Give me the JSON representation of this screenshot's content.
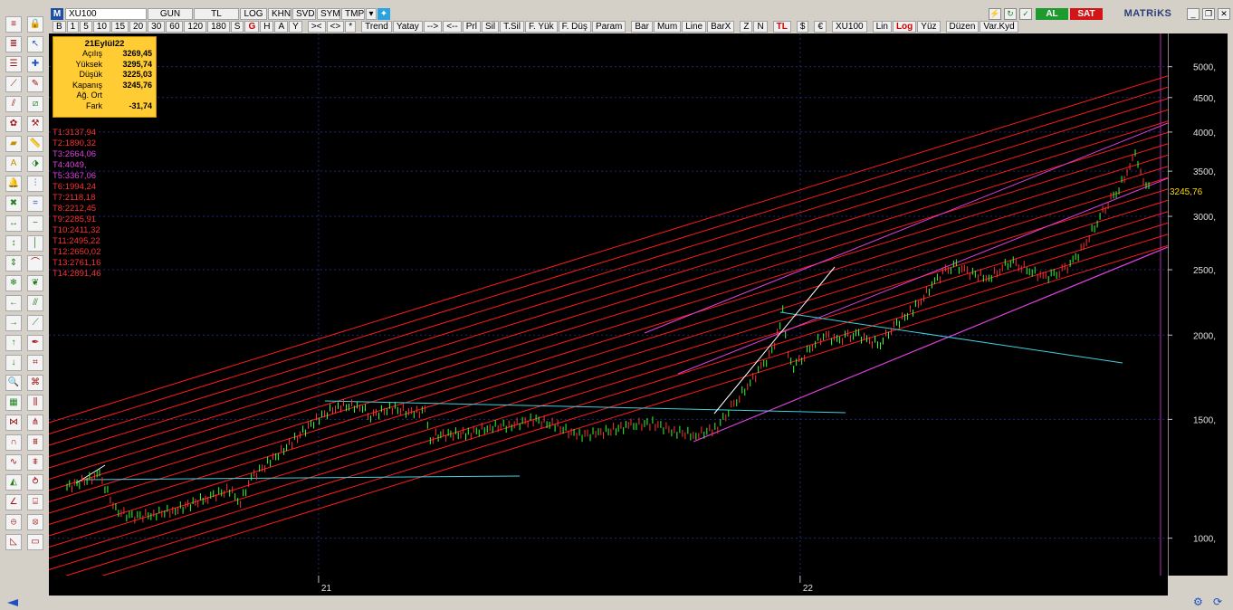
{
  "toolbar1": {
    "m_label": "M",
    "symbol": "XU100",
    "items": [
      "GUN",
      "TL",
      "LOG",
      "KHN",
      "SVD",
      "SYM",
      "TMP"
    ]
  },
  "toolbar2": {
    "periods": [
      "B",
      "1",
      "5",
      "10",
      "15",
      "20",
      "30",
      "60",
      "120",
      "180",
      "S"
    ],
    "g_label": "G",
    "more": [
      "H",
      "A",
      "Y"
    ],
    "nav": [
      "><",
      "<>",
      "*"
    ],
    "tools": [
      "Trend",
      "Yatay",
      "-->",
      "<--",
      "Prl",
      "Sil",
      "T.Sil",
      "F. Yük",
      "F. Düş",
      "Param"
    ],
    "chart_types": [
      "Bar",
      "Mum",
      "Line",
      "BarX"
    ],
    "misc": [
      "Z",
      "N"
    ],
    "tl_label": "TL",
    "currency": [
      "$",
      "€"
    ],
    "symbol2": "XU100",
    "scale_lin": "Lin",
    "scale_log": "Log",
    "pct": "Yüz",
    "edit": "Düzen",
    "save": "Var.Kyd"
  },
  "actions": {
    "buy": "AL",
    "sell": "SAT",
    "brand": "MATRiKS"
  },
  "info_box": {
    "date": "21Eylül22",
    "rows": [
      {
        "k": "Açılış",
        "v": "3269,45"
      },
      {
        "k": "Yüksek",
        "v": "3295,74"
      },
      {
        "k": "Düşük",
        "v": "3225,03"
      },
      {
        "k": "Kapanış",
        "v": "3245,76"
      },
      {
        "k": "Ağ. Ort",
        "v": ""
      },
      {
        "k": "Fark",
        "v": "-31,74"
      }
    ]
  },
  "trend_levels": [
    {
      "label": "T1:3137,94",
      "color": "#ff3030"
    },
    {
      "label": "T2:1890,32",
      "color": "#ff3030"
    },
    {
      "label": "T3:2664,06",
      "color": "#e040e0"
    },
    {
      "label": "T4:4049,",
      "color": "#e040e0"
    },
    {
      "label": "T5:3367,06",
      "color": "#e040e0"
    },
    {
      "label": "T6:1994,24",
      "color": "#ff3030"
    },
    {
      "label": "T7:2118,18",
      "color": "#ff3030"
    },
    {
      "label": "T8:2212,45",
      "color": "#ff3030"
    },
    {
      "label": "T9:2285,91",
      "color": "#ff3030"
    },
    {
      "label": "T10:2411,32",
      "color": "#ff3030"
    },
    {
      "label": "T11:2495,22",
      "color": "#ff3030"
    },
    {
      "label": "T12:2650,02",
      "color": "#ff3030"
    },
    {
      "label": "T13:2761,16",
      "color": "#ff3030"
    },
    {
      "label": "T14:2891,46",
      "color": "#ff3030"
    }
  ],
  "last_price": "3245,76",
  "chart_data": {
    "type": "line",
    "scale": "log",
    "title": "",
    "xlabel": "",
    "ylabel": "",
    "ylim": [
      880,
      5600
    ],
    "y_ticks": [
      {
        "v": 1000,
        "label": "1000,"
      },
      {
        "v": 1500,
        "label": "1500,"
      },
      {
        "v": 2000,
        "label": "2000,"
      },
      {
        "v": 2500,
        "label": "2500,"
      },
      {
        "v": 3000,
        "label": "3000,"
      },
      {
        "v": 3500,
        "label": "3500,"
      },
      {
        "v": 4000,
        "label": "4000,"
      },
      {
        "v": 4500,
        "label": "4500,"
      },
      {
        "v": 5000,
        "label": "5000,"
      }
    ],
    "x_ticks": [
      {
        "t": 0.232,
        "label": "21"
      },
      {
        "t": 0.676,
        "label": "22"
      }
    ],
    "series": [
      {
        "values": [
          [
            0.0,
            1190
          ],
          [
            0.03,
            1240
          ],
          [
            0.045,
            1100
          ],
          [
            0.06,
            1075
          ],
          [
            0.08,
            1085
          ],
          [
            0.1,
            1100
          ],
          [
            0.13,
            1150
          ],
          [
            0.15,
            1180
          ],
          [
            0.16,
            1130
          ],
          [
            0.17,
            1230
          ],
          [
            0.19,
            1310
          ],
          [
            0.21,
            1400
          ],
          [
            0.23,
            1500
          ],
          [
            0.25,
            1570
          ],
          [
            0.27,
            1570
          ],
          [
            0.28,
            1520
          ],
          [
            0.3,
            1560
          ],
          [
            0.32,
            1530
          ],
          [
            0.33,
            1550
          ],
          [
            0.335,
            1380
          ],
          [
            0.34,
            1420
          ],
          [
            0.37,
            1430
          ],
          [
            0.39,
            1460
          ],
          [
            0.41,
            1470
          ],
          [
            0.43,
            1500
          ],
          [
            0.45,
            1470
          ],
          [
            0.47,
            1420
          ],
          [
            0.49,
            1430
          ],
          [
            0.52,
            1470
          ],
          [
            0.54,
            1480
          ],
          [
            0.56,
            1440
          ],
          [
            0.58,
            1420
          ],
          [
            0.6,
            1460
          ],
          [
            0.61,
            1550
          ],
          [
            0.62,
            1620
          ],
          [
            0.63,
            1700
          ],
          [
            0.64,
            1790
          ],
          [
            0.65,
            1880
          ],
          [
            0.655,
            2000
          ],
          [
            0.66,
            2180
          ],
          [
            0.665,
            1880
          ],
          [
            0.67,
            1800
          ],
          [
            0.68,
            1870
          ],
          [
            0.69,
            1950
          ],
          [
            0.7,
            2000
          ],
          [
            0.71,
            1960
          ],
          [
            0.72,
            1990
          ],
          [
            0.73,
            2000
          ],
          [
            0.74,
            1960
          ],
          [
            0.75,
            1940
          ],
          [
            0.76,
            2050
          ],
          [
            0.78,
            2180
          ],
          [
            0.79,
            2280
          ],
          [
            0.8,
            2400
          ],
          [
            0.81,
            2490
          ],
          [
            0.82,
            2530
          ],
          [
            0.83,
            2480
          ],
          [
            0.85,
            2430
          ],
          [
            0.86,
            2500
          ],
          [
            0.87,
            2580
          ],
          [
            0.88,
            2530
          ],
          [
            0.89,
            2480
          ],
          [
            0.9,
            2440
          ],
          [
            0.91,
            2450
          ],
          [
            0.92,
            2500
          ],
          [
            0.93,
            2600
          ],
          [
            0.94,
            2750
          ],
          [
            0.95,
            2950
          ],
          [
            0.96,
            3150
          ],
          [
            0.97,
            3300
          ],
          [
            0.98,
            3560
          ],
          [
            0.985,
            3700
          ],
          [
            0.99,
            3450
          ],
          [
            1.0,
            3246
          ]
        ]
      }
    ]
  }
}
